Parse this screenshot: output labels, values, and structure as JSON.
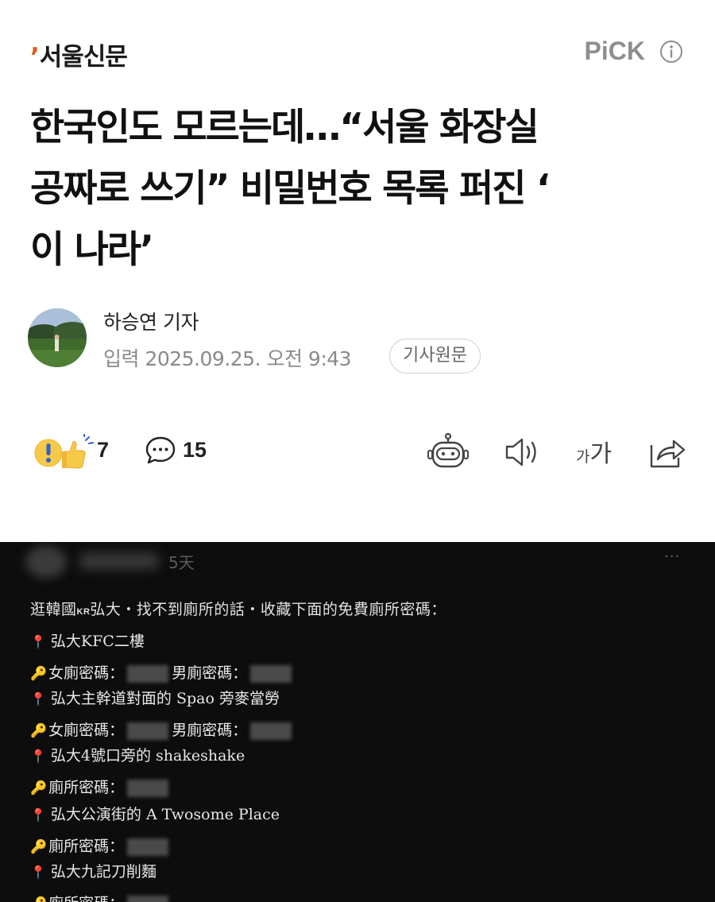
{
  "header": {
    "press_mark": "’",
    "press_name": "서울신문",
    "pick_label": "PiCK"
  },
  "article": {
    "headline_line1": "한국인도 모르는데…“서울 화장실",
    "headline_line2": "공짜로 쓰기” 비밀번호 목록 퍼진 ‘",
    "headline_line3": "이 나라’",
    "reporter": "하승연 기자",
    "dateline": "입력 2025.09.25. 오전 9:43",
    "original_button": "기사원문"
  },
  "toolbar": {
    "reaction_count": "7",
    "comment_count": "15",
    "font_size_small": "가",
    "font_size_large": "가"
  },
  "post": {
    "time": "5天",
    "more": "···",
    "intro_pre": "逛韓國",
    "intro_kr": "KR",
    "intro_post": "弘大・找不到廁所的話・收藏下面的免費廁所密碼：",
    "entries": [
      {
        "place": "弘大KFC二樓",
        "pw1": "女廁密碼：",
        "pw2": "男廁密碼："
      },
      {
        "place": "弘大主幹道對面的 Spao 旁麥當勞",
        "pw1": "女廁密碼：",
        "pw2": "男廁密碼："
      },
      {
        "place": "弘大4號口旁的 shakeshake",
        "pw1": "廁所密碼："
      },
      {
        "place": "弘大公演街的 A Twosome Place",
        "pw1": "廁所密碼："
      },
      {
        "place": "弘大九記刀削麵",
        "pw1": "廁所密碼："
      }
    ]
  },
  "colors": {
    "press_mark": "#e35a1e",
    "pick_gray": "#8e8e8e",
    "dateline_gray": "#8a8a8a",
    "image_bg": "#0d0d0d",
    "pin_red": "#e4646c",
    "key_gold": "#d8a63a"
  }
}
